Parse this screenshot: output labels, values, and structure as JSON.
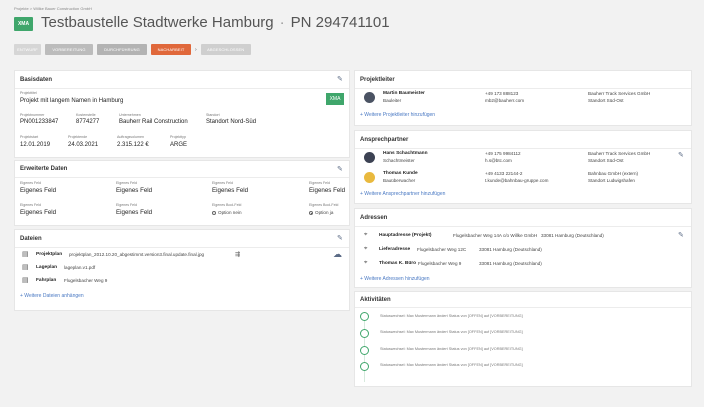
{
  "breadcrumb": "Projekte > Willke Bauer Construction GmbH",
  "logo_text": "XMA",
  "title": {
    "name": "Testbaustelle Stadtwerke Hamburg",
    "separator": "·",
    "pn": "PN 294741101"
  },
  "steps": [
    {
      "label": "ENTWURF"
    },
    {
      "label": "VORBEREITUNG"
    },
    {
      "label": "DURCHFÜHRUNG"
    },
    {
      "label": "NACHARBEIT"
    },
    {
      "label": "ABGESCHLOSSEN"
    }
  ],
  "steps_arrow": "›",
  "basisdaten": {
    "title": "Basisdaten",
    "projekttitel_label": "Projekttitel",
    "projekttitel": "Projekt mit langem Namen in Hamburg",
    "badge": "XMA",
    "fields_row1": [
      {
        "label": "Projektnummer",
        "value": "PN001233847"
      },
      {
        "label": "Kostenstelle",
        "value": "8774277"
      },
      {
        "label": "Unternehmen",
        "value": "Bauherr Rail Construction"
      },
      {
        "label": "Standort",
        "value": "Standort Nord-Süd"
      }
    ],
    "fields_row2": [
      {
        "label": "Projektstart",
        "value": "12.01.2019"
      },
      {
        "label": "Projektende",
        "value": "24.03.2021"
      },
      {
        "label": "Auftragsvolumen",
        "value": "2.315.122 €"
      },
      {
        "label": "Projekttyp",
        "value": "ARGE"
      }
    ]
  },
  "erweitert": {
    "title": "Erweiterte Daten",
    "row1": [
      {
        "label": "Eigenes Feld",
        "value": "Eigenes Feld"
      },
      {
        "label": "Eigenes Feld",
        "value": "Eigenes Feld"
      },
      {
        "label": "Eigenes Feld",
        "value": "Eigenes Feld"
      },
      {
        "label": "Eigenes Feld",
        "value": "Eigenes Feld"
      }
    ],
    "row2": [
      {
        "label": "Eigenes Feld",
        "value": "Eigenes Feld"
      },
      {
        "label": "Eigenes Feld",
        "value": "Eigenes Feld"
      }
    ],
    "bool1": {
      "label": "Eigenes Bool-Feld",
      "value": "Option nein"
    },
    "bool2": {
      "label": "Eigenes Bool-Feld",
      "value": "Option ja"
    }
  },
  "dateien": {
    "title": "Dateien",
    "files": [
      {
        "name": "Projektplan",
        "file": "projektplan_2012.10.20_abgestimmt.version3.final.update.final.jpg"
      },
      {
        "name": "Lageplan",
        "file": "lageplan.v1.pdf"
      },
      {
        "name": "Fahrplan",
        "file": "Flugelsbacher Weg 9"
      }
    ],
    "add": "+ Weitere Dateien anhängen"
  },
  "projektleiter": {
    "title": "Projektleiter",
    "people": [
      {
        "name": "Martin Baumeister",
        "role": "Bauleiter",
        "phone": "+49 173 888123",
        "email": "mb2@bauherr.com",
        "company": "Bauherr Track Services GmbH",
        "location": "Standort Süd-Ost"
      }
    ],
    "add": "+ Weitere Projektleiter hinzufügen"
  },
  "ansprechpartner": {
    "title": "Ansprechpartner",
    "people": [
      {
        "name": "Hans Schachtmann",
        "role": "Schachtmeister",
        "phone": "+49 175 9984112",
        "email": "h.s@btc.com",
        "company": "Bauherr Track Services GmbH",
        "location": "Standort Süd-Ost"
      },
      {
        "name": "Thomas Kunde",
        "role": "Bauüberwacher",
        "phone": "+49 4133 22144-2",
        "email": "t.kunde@bahnbau-gruppe.com",
        "company": "Bahnbau GmbH (extern)",
        "location": "Standort Ludwigshafen"
      }
    ],
    "add": "+ Weitere Ansprechpartner hinzufügen"
  },
  "adressen": {
    "title": "Adressen",
    "items": [
      {
        "type": "Hauptadresse (Projekt)",
        "street": "Flugelsbacher Weg 14A c/o Willke GmbH",
        "city": "33081 Hamburg (Deutschland)"
      },
      {
        "type": "Lieferadresse",
        "street": "Flugelsbacher Weg 12C",
        "city": "33081 Hamburg (Deutschland)"
      },
      {
        "type": "Thomas K. Büro",
        "street": "Flugelsbacher Weg 9",
        "city": "33081 Hamburg (Deutschland)"
      }
    ],
    "add": "+ Weitere Adressen hinzufügen"
  },
  "aktivitaeten": {
    "title": "Aktivitäten",
    "items": [
      {
        "text": "Statuswechsel: Max Mustermann ändert Status von [OFFEN] auf [VORBEREITUNG]"
      },
      {
        "text": "Statuswechsel: Max Mustermann ändert Status von [OFFEN] auf [VORBEREITUNG]"
      },
      {
        "text": "Statuswechsel: Max Mustermann ändert Status von [OFFEN] auf [VORBEREITUNG]"
      },
      {
        "text": "Statuswechsel: Max Mustermann ändert Status von [OFFEN] auf [VORBEREITUNG]"
      }
    ]
  },
  "colors": {
    "accent_green": "#3fa66b",
    "accent_orange": "#e0683b",
    "link_blue": "#4a79c3"
  },
  "icons": {
    "edit": "pencil-icon",
    "file": "document-icon",
    "address": "map-pin-icon",
    "cloud": "cloud-upload-icon"
  }
}
